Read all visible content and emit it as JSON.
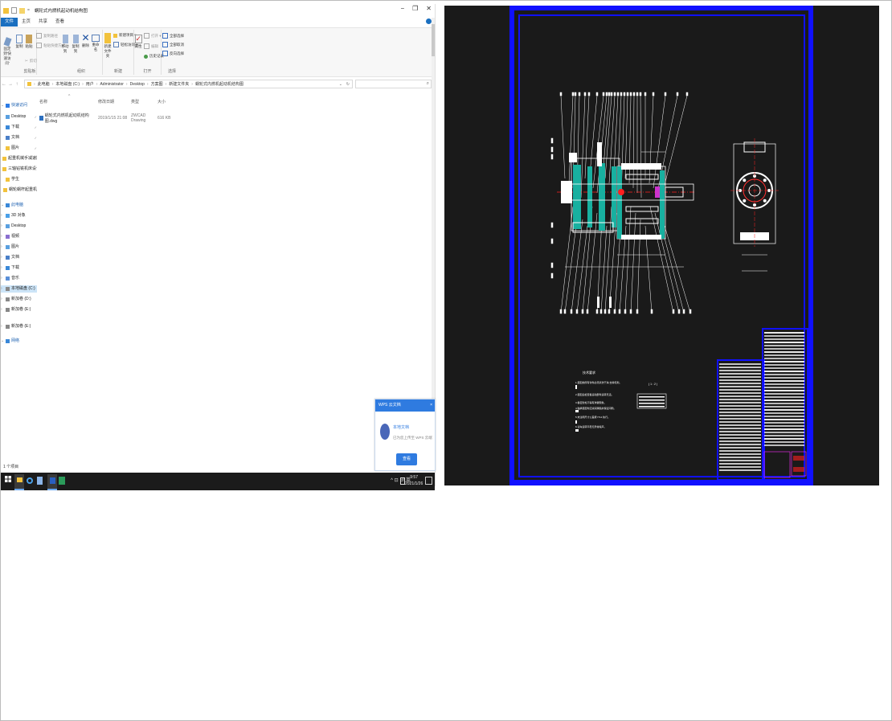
{
  "explorer": {
    "window_title": "蜗轮式内燃机起动机结构图",
    "controls": {
      "minimize": "−",
      "maximize": "❐",
      "close": "✕"
    },
    "tabs": [
      "文件",
      "主页",
      "共享",
      "查看"
    ],
    "ribbon": {
      "groups": [
        {
          "label": "剪贴板",
          "buttons": [
            "固定到'快速访问'",
            "复制",
            "粘贴",
            "剪切"
          ],
          "small": [
            "复制路径",
            "粘贴快捷方式"
          ]
        },
        {
          "label": "组织",
          "buttons": [
            "移动到",
            "复制到",
            "删除",
            "重命名"
          ]
        },
        {
          "label": "新建",
          "buttons": [
            "新建文件夹"
          ],
          "small": [
            "新建项目 ▾",
            "轻松访问 ▾"
          ]
        },
        {
          "label": "打开",
          "buttons": [
            "属性"
          ],
          "small": [
            "打开 ▾",
            "编辑",
            "历史记录"
          ]
        },
        {
          "label": "选择",
          "small": [
            "全部选择",
            "全部取消",
            "反向选择"
          ]
        }
      ]
    },
    "address": {
      "back": "←",
      "forward": "→",
      "up": "↑",
      "crumbs": [
        "此电脑",
        "本地磁盘 (C:)",
        "用户",
        "Administrator",
        "Desktop",
        "方案图",
        "新建文件夹",
        "蜗轮式内燃机起动机结构图"
      ],
      "refresh": "↻"
    },
    "nav": [
      {
        "label": "快速访问",
        "type": "header",
        "icon": "star-icon"
      },
      {
        "label": "Desktop",
        "pin": "✓"
      },
      {
        "label": "下载",
        "pin": "✓"
      },
      {
        "label": "文档",
        "pin": "✓"
      },
      {
        "label": "图片",
        "pin": "✓"
      },
      {
        "label": "起重机械手减速器设计"
      },
      {
        "label": "三轴钻铣机床设计"
      },
      {
        "label": "学生"
      },
      {
        "label": "蜗轮蜗杆起重机"
      },
      {
        "label": "此电脑",
        "type": "header",
        "icon": "computer-icon"
      },
      {
        "label": "3D 对象"
      },
      {
        "label": "Desktop"
      },
      {
        "label": "视频"
      },
      {
        "label": "图片"
      },
      {
        "label": "文档"
      },
      {
        "label": "下载"
      },
      {
        "label": "音乐"
      },
      {
        "label": "本地磁盘 (C:)",
        "selected": true
      },
      {
        "label": "新加卷 (D:)"
      },
      {
        "label": "新加卷 (E:)"
      },
      {
        "label": "新加卷 (E:)"
      },
      {
        "label": "网络",
        "type": "header",
        "icon": "network-icon"
      }
    ],
    "columns": [
      "名称",
      "修改日期",
      "类型",
      "大小"
    ],
    "files": [
      {
        "name": "蜗轮式内燃机起动机结构图.dwg",
        "date": "2019/1/15 21:08",
        "type": "ZWCAD Drawing",
        "size": "616 KB"
      }
    ],
    "status": "1 个项目",
    "popup": {
      "title": "WPS 云文档",
      "close": "×",
      "line1": "本地文档",
      "line2": "已为您上传至 WPS 云端",
      "button": "查看"
    },
    "taskbar": {
      "tray": "^ ⊡ ⊕ 英",
      "time": "9:57",
      "date": "2021/1/26"
    }
  },
  "cad": {
    "colors": {
      "background": "#1a1a1a",
      "border": "#1010ff",
      "lines": "#ffffff",
      "teal": "#18b0a0",
      "center": "#ff2020"
    },
    "notes_title": "技术要求",
    "note_lines": [
      "1.装配前所有零件必须清洗干净,去除毛刺。",
      "2.装配后检查各运动部件运转灵活。",
      "3.各密封处不得有渗漏现象。",
      "4.轴承装配时应涂润滑脂并保证间隙。",
      "5.未注明尺寸公差按 IT12 执行。",
      "6.试车运转平稳无异常噪声。"
    ],
    "section_label": "( 1 : 2 )"
  }
}
